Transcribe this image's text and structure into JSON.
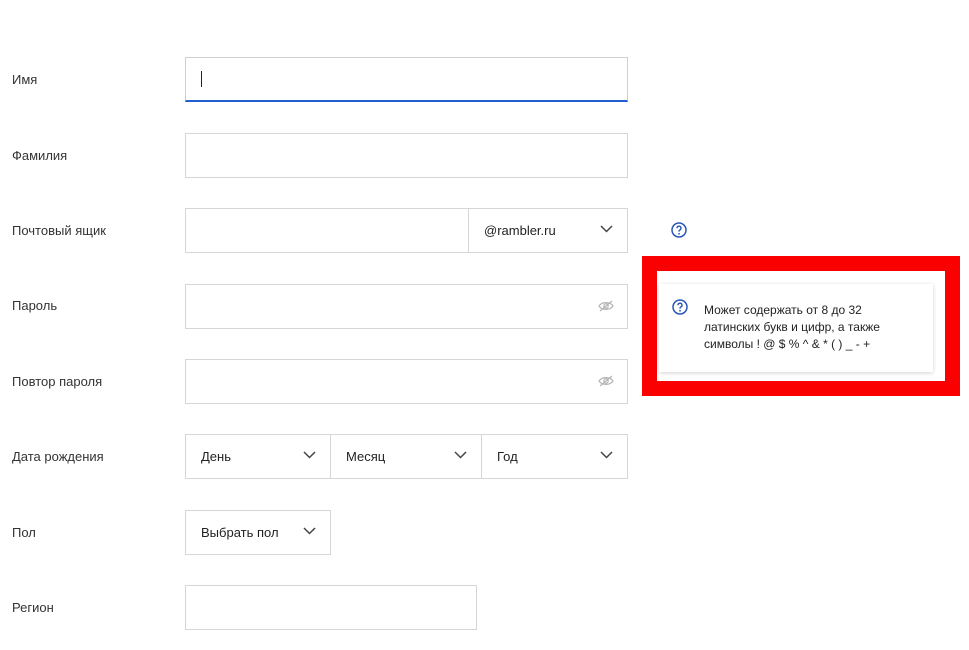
{
  "fields": {
    "name": {
      "label": "Имя",
      "value": ""
    },
    "surname": {
      "label": "Фамилия",
      "value": ""
    },
    "mailbox": {
      "label": "Почтовый ящик",
      "value": "",
      "domain": "@rambler.ru"
    },
    "password": {
      "label": "Пароль",
      "value": ""
    },
    "password_repeat": {
      "label": "Повтор пароля",
      "value": ""
    },
    "birthdate": {
      "label": "Дата рождения",
      "day": "День",
      "month": "Месяц",
      "year": "Год"
    },
    "gender": {
      "label": "Пол",
      "value": "Выбрать пол"
    },
    "region": {
      "label": "Регион",
      "value": ""
    }
  },
  "tooltip": {
    "line1": "Может содержать от 8 до 32",
    "line2": "латинских букв и цифр, а также",
    "line3": "символы ! @ $ % ^ & * ( ) _ - +"
  },
  "colors": {
    "accent": "#1f5fd1",
    "highlight_frame": "#fb0000",
    "border": "#d6d6d6",
    "icon": "#2a56b8"
  },
  "icons": [
    "help-icon",
    "chevron-down-icon",
    "eye-icon"
  ]
}
